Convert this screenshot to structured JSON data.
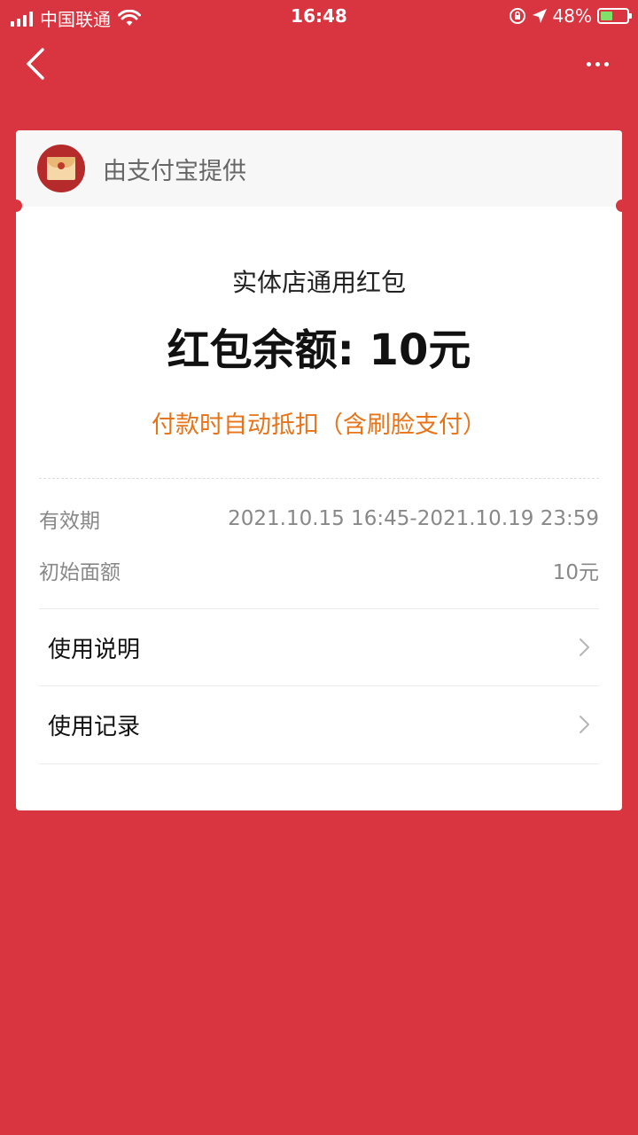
{
  "status_bar": {
    "carrier": "中国联通",
    "time": "16:48",
    "battery": "48%",
    "battery_level": 0.48
  },
  "card": {
    "provider": "由支付宝提供",
    "title": "实体店通用红包",
    "balance": "红包余额: 10元",
    "deduct_note": "付款时自动抵扣（含刷脸支付）",
    "validity_label": "有效期",
    "validity_value": "2021.10.15 16:45-2021.10.19 23:59",
    "initial_label": "初始面额",
    "initial_value": "10元",
    "links": [
      {
        "label": "使用说明"
      },
      {
        "label": "使用记录"
      }
    ]
  },
  "colors": {
    "background": "#d93540",
    "accent_orange": "#e8741a"
  }
}
